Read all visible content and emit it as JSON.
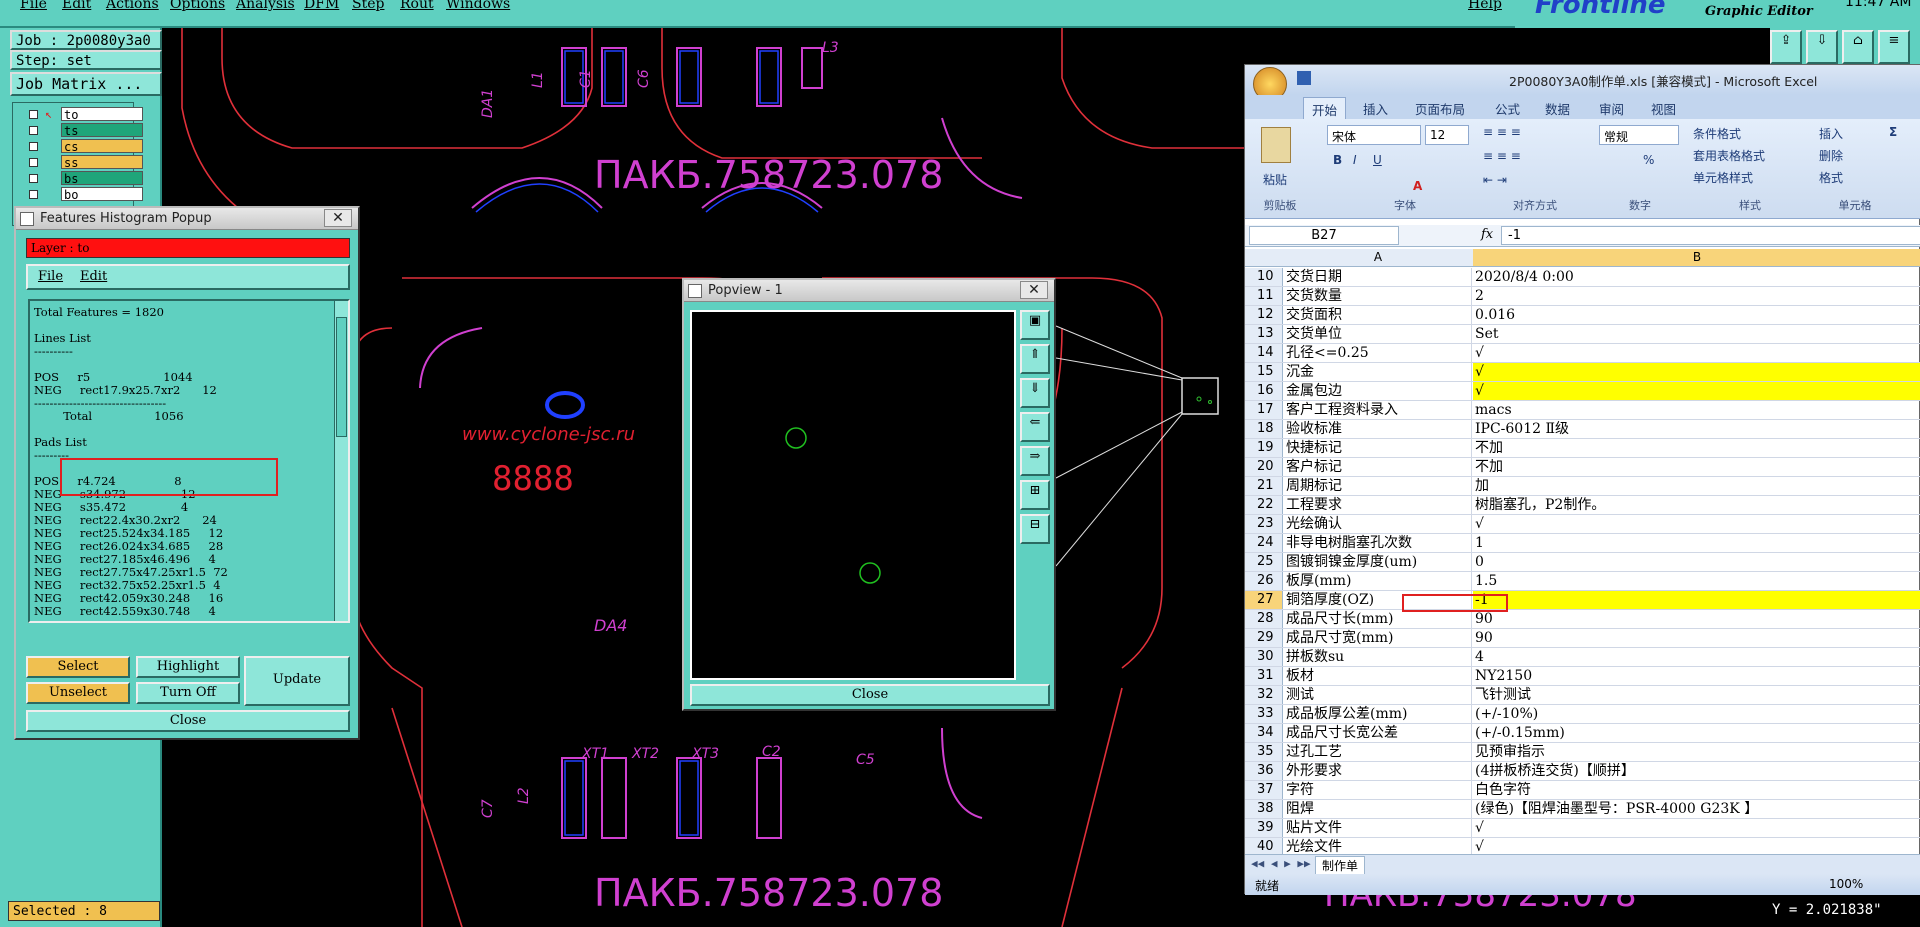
{
  "menubar": {
    "items": [
      "File",
      "Edit",
      "Actions",
      "Options",
      "Analysis",
      "DFM",
      "Step",
      "Rout",
      "Windows",
      "Help"
    ],
    "brand": "Frontline",
    "subtitle": "Graphic Editor",
    "clock": "11:47 AM"
  },
  "left_panel": {
    "job": "Job : 2p0080y3a0",
    "step": "Step: set",
    "job_matrix": "Job Matrix ...",
    "layers": [
      {
        "name": "to",
        "color": "#ffffff",
        "active": true
      },
      {
        "name": "ts",
        "color": "#1fa57a"
      },
      {
        "name": "cs",
        "color": "#f0c050"
      },
      {
        "name": "ss",
        "color": "#f0c050"
      },
      {
        "name": "bs",
        "color": "#1fa57a"
      },
      {
        "name": "bo",
        "color": "#ffffff"
      }
    ],
    "selected": "Selected : 8"
  },
  "histogram": {
    "title": "Features Histogram Popup",
    "layer": "Layer :  to",
    "menu": [
      "File",
      "Edit"
    ],
    "lines": [
      "Total Features = 1820",
      "",
      "Lines List",
      "----------",
      "",
      "POS     r5                    1044",
      "NEG     rect17.9x25.7xr2      12",
      "----------------------------------",
      "        Total                 1056",
      "",
      "Pads List",
      "---------",
      "",
      "POS     r4.724                8",
      "NEG     s34.972               12",
      "NEG     s35.472               4",
      "NEG     rect22.4x30.2xr2      24",
      "NEG     rect25.524x34.185     12",
      "NEG     rect26.024x34.685     28",
      "NEG     rect27.185x46.496     4",
      "NEG     rect27.75x47.25xr1.5  72",
      "NEG     rect32.75x52.25xr1.5  4",
      "NEG     rect42.059x30.248     16",
      "NEG     rect42.559x30.748     4"
    ],
    "buttons": {
      "select": "Select",
      "highlight": "Highlight",
      "update": "Update",
      "unselect": "Unselect",
      "turn_off": "Turn Off",
      "close": "Close"
    }
  },
  "popview": {
    "title": "Popview - 1",
    "close": "Close"
  },
  "canvas": {
    "board_text": "ПАКБ.758723.078",
    "url_text": "www.cyclone-jsc.ru",
    "digits": "8888",
    "labels": [
      "DA1",
      "L1",
      "C1",
      "C6",
      "L3",
      "XT1",
      "XT2",
      "XT3",
      "C2",
      "C7",
      "L2",
      "C5",
      "DA4"
    ],
    "coord": "Y = 2.021838\""
  },
  "excel": {
    "title": "2P0080Y3A0制作单.xls  [兼容模式]  -  Microsoft Excel",
    "tabs": [
      "开始",
      "插入",
      "页面布局",
      "公式",
      "数据",
      "审阅",
      "视图"
    ],
    "font_name": "宋体",
    "font_size": "12",
    "number_format": "常规",
    "paste": "粘贴",
    "groups": [
      "剪贴板",
      "字体",
      "对齐方式",
      "数字",
      "样式",
      "单元格"
    ],
    "style_items": [
      "条件格式",
      "套用表格格式",
      "单元格样式"
    ],
    "cell_items": [
      "插入",
      "删除",
      "格式"
    ],
    "name_box": "B27",
    "formula": "-1",
    "col_a": "A",
    "col_b": "B",
    "rows": [
      {
        "n": "10",
        "a": "交货日期",
        "b": "2020/8/4 0:00"
      },
      {
        "n": "11",
        "a": "交货数量",
        "b": "2"
      },
      {
        "n": "12",
        "a": "交货面积",
        "b": "0.016"
      },
      {
        "n": "13",
        "a": "交货单位",
        "b": "Set"
      },
      {
        "n": "14",
        "a": "孔径<=0.25",
        "b": "√"
      },
      {
        "n": "15",
        "a": "沉金",
        "b": "√",
        "y": true
      },
      {
        "n": "16",
        "a": "金属包边",
        "b": "√",
        "y": true
      },
      {
        "n": "17",
        "a": "客户工程资料录入",
        "b": "macs"
      },
      {
        "n": "18",
        "a": "验收标准",
        "b": "IPC-6012 Ⅱ级"
      },
      {
        "n": "19",
        "a": "快捷标记",
        "b": "不加"
      },
      {
        "n": "20",
        "a": "客户标记",
        "b": "不加"
      },
      {
        "n": "21",
        "a": "周期标记",
        "b": "加"
      },
      {
        "n": "22",
        "a": "工程要求",
        "b": "树脂塞孔，P2制作。"
      },
      {
        "n": "23",
        "a": "光绘确认",
        "b": "√"
      },
      {
        "n": "24",
        "a": "非导电树脂塞孔次数",
        "b": "1"
      },
      {
        "n": "25",
        "a": "图镀铜镍金厚度(um)",
        "b": "0"
      },
      {
        "n": "26",
        "a": "板厚(mm)",
        "b": "1.5"
      },
      {
        "n": "27",
        "a": "铜箔厚度(OZ)",
        "b": "-1",
        "y": true,
        "active": true
      },
      {
        "n": "28",
        "a": "成品尺寸长(mm)",
        "b": "90"
      },
      {
        "n": "29",
        "a": "成品尺寸宽(mm)",
        "b": "90"
      },
      {
        "n": "30",
        "a": "拼板数su",
        "b": "4"
      },
      {
        "n": "31",
        "a": "板材",
        "b": "NY2150"
      },
      {
        "n": "32",
        "a": "测试",
        "b": "飞针测试"
      },
      {
        "n": "33",
        "a": "成品板厚公差(mm)",
        "b": "(+/-10%)"
      },
      {
        "n": "34",
        "a": "成品尺寸长宽公差",
        "b": "(+/-0.15mm)"
      },
      {
        "n": "35",
        "a": "过孔工艺",
        "b": "见预审指示"
      },
      {
        "n": "36",
        "a": "外形要求",
        "b": "(4拼板桥连交货)【顺拼】"
      },
      {
        "n": "37",
        "a": "字符",
        "b": "白色字符"
      },
      {
        "n": "38",
        "a": "阻焊",
        "b": "(绿色)【阻焊油墨型号：PSR-4000 G23K 】"
      },
      {
        "n": "39",
        "a": "贴片文件",
        "b": "√"
      },
      {
        "n": "40",
        "a": "光绘文件",
        "b": "√"
      }
    ],
    "sheet_tab": "制作单",
    "status": "就绪",
    "zoom": "100%"
  }
}
